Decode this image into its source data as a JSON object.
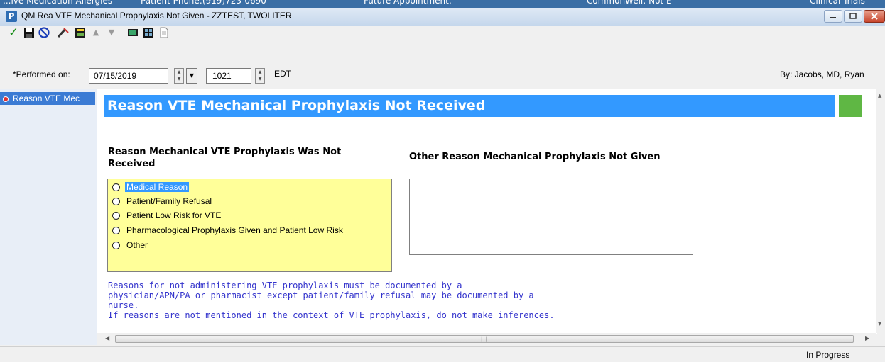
{
  "background_strip": [
    "...ive Medication Allergies",
    "Patient Phone:(919)723-0690",
    "Future Appointment:",
    "CommonWell: Not E",
    "Clinical Trials"
  ],
  "window": {
    "title": "QM Rea VTE Mechanical Prophylaxis Not Given - ZZTEST, TWOLITER",
    "app_icon": "P"
  },
  "toolbar": {
    "icons": [
      "checkmark-icon",
      "save-icon",
      "cancel-icon",
      "edit-icon",
      "document-icon",
      "up-arrow-icon",
      "down-arrow-icon",
      "calculator-icon",
      "calendar-icon",
      "page-icon"
    ]
  },
  "performed": {
    "label": "*Performed on:",
    "date": "07/15/2019",
    "time": "1021",
    "timezone": "EDT",
    "by": "By:  Jacobs, MD, Ryan"
  },
  "nav": {
    "items": [
      {
        "label": "Reason VTE Mec"
      }
    ]
  },
  "form": {
    "header": "Reason VTE Mechanical Prophylaxis Not Received",
    "reason_label": "Reason Mechanical VTE Prophylaxis Was Not Received",
    "other_label": "Other Reason Mechanical Prophylaxis Not Given",
    "options": [
      {
        "label": "Medical Reason",
        "selected": true
      },
      {
        "label": "Patient/Family Refusal",
        "selected": false
      },
      {
        "label": "Patient Low Risk for VTE",
        "selected": false
      },
      {
        "label": "Pharmacological Prophylaxis Given and Patient Low Risk",
        "selected": false
      },
      {
        "label": "Other",
        "selected": false
      }
    ],
    "note_lines": [
      "Reasons for not administering VTE prophylaxis must be documented by a",
      "physician/APN/PA or pharmacist except patient/family refusal may be documented by a",
      "nurse.",
      "If reasons are not mentioned in the context of VTE prophylaxis, do not make inferences."
    ]
  },
  "status": {
    "text": "In Progress"
  },
  "colors": {
    "header": "#3399ff",
    "green_indicator": "#5fb744",
    "radio_box": "#ffff99",
    "note_text": "#3333cc"
  }
}
